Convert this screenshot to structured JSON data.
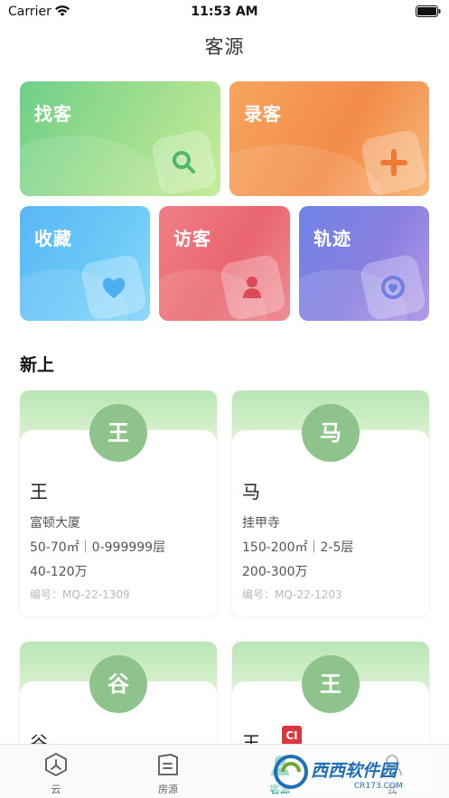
{
  "status_bar": {
    "carrier": "Carrier",
    "time": "11:53 AM"
  },
  "nav": {
    "title": "客源"
  },
  "tiles": {
    "find": {
      "label": "找客",
      "icon": "search-icon"
    },
    "add": {
      "label": "录客",
      "icon": "plus-icon"
    },
    "favorites": {
      "label": "收藏",
      "icon": "heart-icon"
    },
    "visitors": {
      "label": "访客",
      "icon": "person-icon"
    },
    "track": {
      "label": "轨迹",
      "icon": "target-icon"
    }
  },
  "section": {
    "title": "新上"
  },
  "cards": [
    {
      "avatar": "王",
      "name": "王",
      "building": "富顿大厦",
      "spec": "50-70㎡｜0-999999层",
      "price": "40-120万",
      "code": "编号：MQ-22-1309"
    },
    {
      "avatar": "马",
      "name": "马",
      "building": "挂甲寺",
      "spec": "150-200㎡｜2-5层",
      "price": "200-300万",
      "code": "编号：MQ-22-1203"
    },
    {
      "avatar": "谷",
      "name": "谷"
    },
    {
      "avatar": "王",
      "name": "王",
      "badge": "CI"
    }
  ],
  "tab_bar": {
    "tabs": [
      {
        "label": "云",
        "icon": "cloud-hex-icon"
      },
      {
        "label": "房源",
        "icon": "house-doc-icon"
      },
      {
        "label": "客源",
        "icon": "customer-icon",
        "active": true
      },
      {
        "label": "我",
        "icon": "profile-icon"
      }
    ]
  },
  "watermark": {
    "text": "西西软件园",
    "sub": "CR173.COM"
  },
  "colors": {
    "accent": "#2fa9a0",
    "avatar": "#8ec48c",
    "find": "#6ed089",
    "add": "#f38b48",
    "favorites": "#5ab7f5",
    "visitors": "#e9656f",
    "track": "#8a7fe0"
  }
}
